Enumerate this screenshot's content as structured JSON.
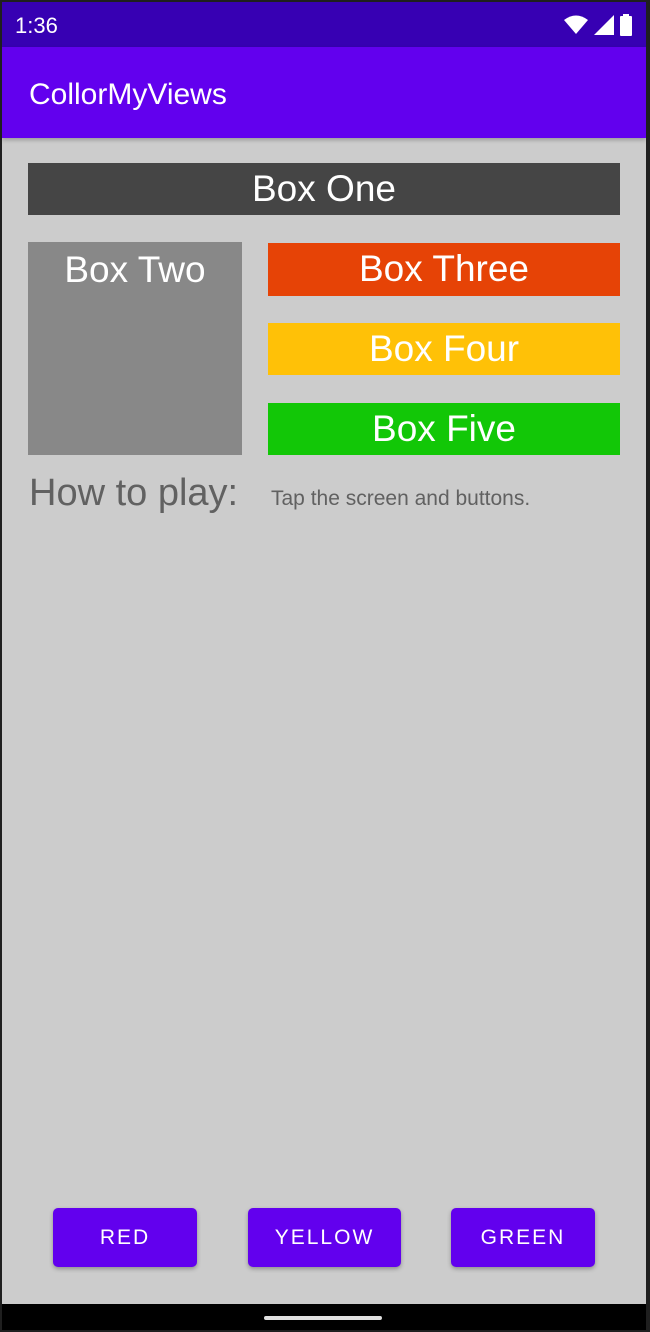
{
  "status_bar": {
    "time": "1:36",
    "icons": [
      "wifi-icon",
      "cell-signal-icon",
      "battery-icon"
    ]
  },
  "app_bar": {
    "title": "CollorMyViews"
  },
  "boxes": {
    "one": {
      "label": "Box One",
      "color": "#454545"
    },
    "two": {
      "label": "Box Two",
      "color": "#888888"
    },
    "three": {
      "label": "Box Three",
      "color": "#e64306"
    },
    "four": {
      "label": "Box Four",
      "color": "#ffc107"
    },
    "five": {
      "label": "Box Five",
      "color": "#12c707"
    }
  },
  "how_to_play": {
    "label": "How to play:",
    "text": "Tap the screen and buttons."
  },
  "buttons": {
    "red": "RED",
    "yellow": "YELLOW",
    "green": "GREEN"
  },
  "colors": {
    "primary": "#6200ee",
    "primary_dark": "#3700b3",
    "background": "#cccccc"
  }
}
